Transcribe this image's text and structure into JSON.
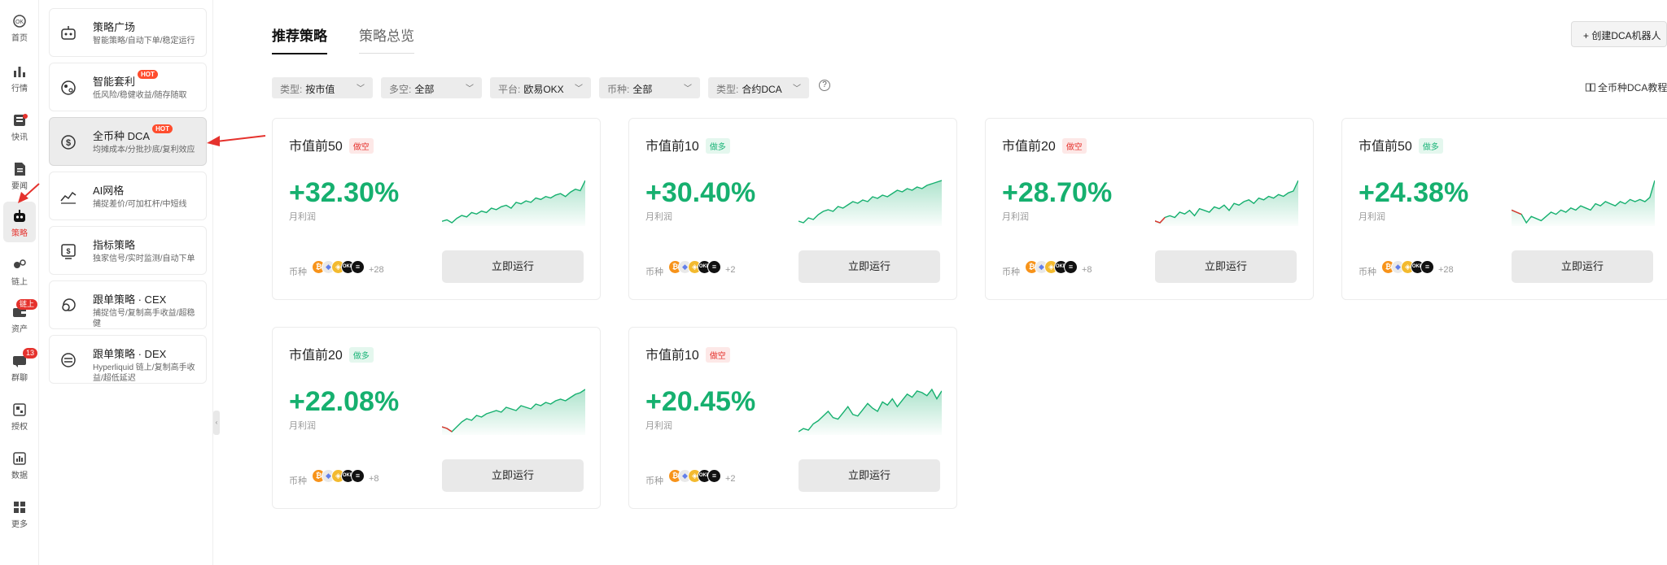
{
  "rail": [
    {
      "label": "首页",
      "icon": "home-icon"
    },
    {
      "label": "行情",
      "icon": "market-chart-icon"
    },
    {
      "label": "快讯",
      "icon": "news-flash-icon"
    },
    {
      "label": "要闻",
      "icon": "headline-doc-icon"
    },
    {
      "label": "策略",
      "icon": "robot-icon",
      "active": true
    },
    {
      "label": "链上",
      "icon": "onchain-icon"
    },
    {
      "label": "资产",
      "icon": "wallet-icon",
      "badge": "链上"
    },
    {
      "label": "群聊",
      "icon": "chat-icon",
      "badge": "13"
    },
    {
      "label": "授权",
      "icon": "authorize-icon"
    },
    {
      "label": "数据",
      "icon": "data-icon"
    },
    {
      "label": "更多",
      "icon": "more-grid-icon"
    }
  ],
  "sidebar": {
    "items": [
      {
        "title": "策略广场",
        "desc": "智能策略/自动下单/稳定运行",
        "icon": "robot-face-icon"
      },
      {
        "title": "智能套利",
        "desc": "低风险/稳健收益/随存随取",
        "icon": "arbitrage-cycle-icon",
        "hot": "HOT"
      },
      {
        "title": "全币种 DCA",
        "desc": "均摊成本/分批抄底/复利效应",
        "icon": "dca-coin-icon",
        "hot": "HOT",
        "active": true
      },
      {
        "title": "AI网格",
        "desc": "捕捉差价/可加杠杆/中短线",
        "icon": "grid-chart-icon"
      },
      {
        "title": "指标策略",
        "desc": "独家信号/实时监测/自动下单",
        "icon": "indicator-monitor-icon"
      },
      {
        "title": "跟单策略 · CEX",
        "desc": "捕捉信号/复制高手收益/超稳健",
        "icon": "copy-trade-icon"
      },
      {
        "title": "跟单策略 · DEX",
        "desc": "Hyperliquid 链上/复制高手收益/超低延迟",
        "icon": "dex-swap-icon"
      }
    ]
  },
  "tabs": [
    {
      "label": "推荐策略",
      "active": true
    },
    {
      "label": "策略总览",
      "active": false
    }
  ],
  "create_button": "+ 创建DCA机器人",
  "filters": [
    {
      "label": "类型:",
      "value": "按市值"
    },
    {
      "label": "多空:",
      "value": "全部"
    },
    {
      "label": "平台:",
      "value": "欧易OKX"
    },
    {
      "label": "币种:",
      "value": "全部"
    },
    {
      "label": "类型:",
      "value": "合约DCA"
    }
  ],
  "help_glyph": "?",
  "tutorial_link": "全币种DCA教程",
  "profit_label": "月利润",
  "coins_label": "币种",
  "run_label": "立即运行",
  "cards": [
    {
      "title": "市值前50",
      "tag": "做空",
      "side": "short",
      "profit": "+32.30%",
      "extra": "+28",
      "series": [
        2,
        3,
        1,
        4,
        6,
        5,
        8,
        7,
        9,
        8,
        11,
        10,
        12,
        13,
        11,
        15,
        14,
        16,
        15,
        18,
        17,
        19,
        18,
        20,
        21,
        19,
        22,
        24,
        23,
        30
      ]
    },
    {
      "title": "市值前10",
      "tag": "做多",
      "side": "long",
      "profit": "+30.40%",
      "extra": "+2",
      "series": [
        2,
        1,
        4,
        3,
        6,
        8,
        9,
        8,
        11,
        10,
        12,
        14,
        13,
        15,
        14,
        17,
        16,
        18,
        17,
        19,
        21,
        20,
        22,
        21,
        23,
        22,
        24,
        25,
        26,
        27
      ]
    },
    {
      "title": "市值前20",
      "tag": "做空",
      "side": "short",
      "profit": "+28.70%",
      "extra": "+8",
      "series": [
        3,
        2,
        5,
        6,
        5,
        8,
        7,
        9,
        6,
        10,
        9,
        8,
        11,
        10,
        12,
        9,
        13,
        12,
        14,
        15,
        13,
        16,
        15,
        17,
        16,
        18,
        17,
        19,
        20,
        26
      ]
    },
    {
      "title": "市值前50",
      "tag": "做多",
      "side": "long",
      "profit": "+24.38%",
      "extra": "+28",
      "series": [
        14,
        13,
        12,
        8,
        11,
        10,
        9,
        11,
        13,
        12,
        14,
        13,
        15,
        14,
        16,
        15,
        14,
        17,
        16,
        18,
        17,
        16,
        18,
        17,
        19,
        18,
        19,
        18,
        20,
        28
      ]
    },
    {
      "title": "市值前20",
      "tag": "做多",
      "side": "long",
      "profit": "+22.08%",
      "extra": "+8",
      "series": [
        6,
        5,
        3,
        6,
        9,
        11,
        10,
        13,
        12,
        14,
        15,
        16,
        15,
        18,
        17,
        16,
        19,
        18,
        17,
        20,
        19,
        21,
        20,
        22,
        23,
        22,
        24,
        26,
        27,
        29
      ]
    },
    {
      "title": "市值前10",
      "tag": "做空",
      "side": "short",
      "profit": "+20.45%",
      "extra": "+2",
      "series": [
        2,
        4,
        3,
        7,
        9,
        12,
        15,
        11,
        10,
        14,
        18,
        13,
        12,
        16,
        20,
        17,
        15,
        21,
        19,
        23,
        18,
        22,
        26,
        24,
        28,
        27,
        25,
        29,
        23,
        28
      ]
    }
  ],
  "coins": [
    {
      "name": "btc",
      "glyph": "₿"
    },
    {
      "name": "eth",
      "glyph": "◆"
    },
    {
      "name": "bnb",
      "glyph": "◈"
    },
    {
      "name": "okb",
      "glyph": "OKB"
    },
    {
      "name": "sol",
      "glyph": "≡"
    }
  ],
  "colors": {
    "profit": "#16b06f",
    "loss": "#e5322d",
    "short_tag": "#e5322d",
    "long_tag": "#1ab478",
    "accent": "#e5322d"
  }
}
